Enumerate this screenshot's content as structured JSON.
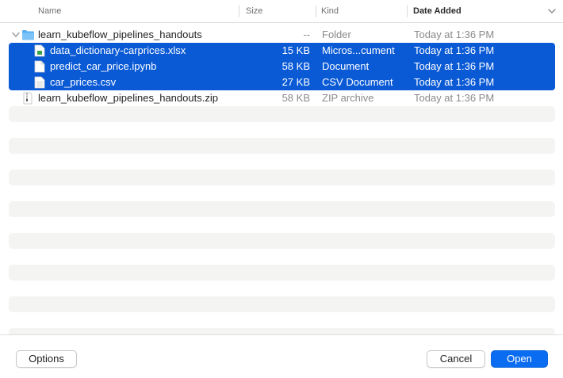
{
  "columns": {
    "name": "Name",
    "size": "Size",
    "kind": "Kind",
    "date_added": "Date Added"
  },
  "files": [
    {
      "name": "learn_kubeflow_pipelines_handouts",
      "size": "--",
      "kind": "Folder",
      "date": "Today at 1:36 PM",
      "icon": "folder-icon",
      "expanded": true,
      "selected": false
    },
    {
      "name": "data_dictionary-carprices.xlsx",
      "size": "15 KB",
      "kind": "Micros...cument",
      "date": "Today at 1:36 PM",
      "icon": "spreadsheet-file-icon",
      "selected": true
    },
    {
      "name": "predict_car_price.ipynb",
      "size": "58 KB",
      "kind": "Document",
      "date": "Today at 1:36 PM",
      "icon": "document-file-icon",
      "selected": true
    },
    {
      "name": "car_prices.csv",
      "size": "27 KB",
      "kind": "CSV Document",
      "date": "Today at 1:36 PM",
      "icon": "csv-file-icon",
      "selected": true
    },
    {
      "name": "learn_kubeflow_pipelines_handouts.zip",
      "size": "58 KB",
      "kind": "ZIP archive",
      "date": "Today at 1:36 PM",
      "icon": "zip-file-icon",
      "selected": false
    }
  ],
  "footer": {
    "options_label": "Options",
    "cancel_label": "Cancel",
    "open_label": "Open"
  },
  "colors": {
    "selection": "#0a5ad6",
    "primary_button": "#0a6cf0",
    "folder": "#5aaff0"
  }
}
